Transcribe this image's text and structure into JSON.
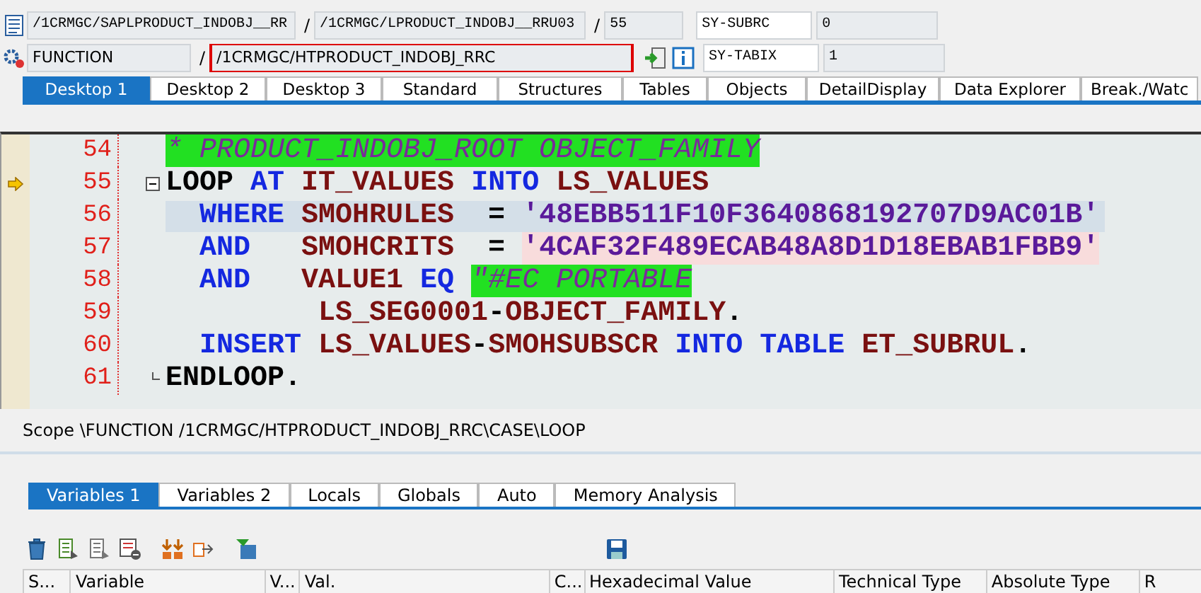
{
  "header": {
    "program": "/1CRMGC/SAPLPRODUCT_INDOBJ__RR",
    "separator_1": "/",
    "include": "/1CRMGC/LPRODUCT_INDOBJ__RRU03",
    "separator_2": "/",
    "line": "55",
    "event_type": "FUNCTION",
    "separator_3": "/",
    "event": "/1CRMGC/HTPRODUCT_INDOBJ_RRC",
    "sys_fields": [
      {
        "name": "SY-SUBRC",
        "value": "0"
      },
      {
        "name": "SY-TABIX",
        "value": "1"
      }
    ]
  },
  "desktop_tabs": [
    {
      "label": "Desktop 1",
      "selected": true
    },
    {
      "label": "Desktop 2",
      "selected": false
    },
    {
      "label": "Desktop 3",
      "selected": false
    },
    {
      "label": "Standard",
      "selected": false
    },
    {
      "label": "Structures",
      "selected": false
    },
    {
      "label": "Tables",
      "selected": false
    },
    {
      "label": "Objects",
      "selected": false
    },
    {
      "label": "DetailDisplay",
      "selected": false
    },
    {
      "label": "Data Explorer",
      "selected": false
    },
    {
      "label": "Break./Watc",
      "selected": false
    }
  ],
  "code_lines": [
    {
      "number": "54",
      "selected": false,
      "tokens": [
        {
          "text": "* PRODUCT_INDOBJ_ROOT OBJECT_FAMILY",
          "kind": "comment",
          "highlighted": true
        }
      ]
    },
    {
      "number": "55",
      "current": true,
      "selected": false,
      "fold_start": true,
      "tokens": [
        {
          "text": "LOOP",
          "kind": "statement"
        },
        {
          "text": " AT",
          "kind": "keyword"
        },
        {
          "text": " IT_VALUES",
          "kind": "ident"
        },
        {
          "text": " INTO",
          "kind": "keyword"
        },
        {
          "text": " LS_VALUES",
          "kind": "ident"
        }
      ]
    },
    {
      "number": "56",
      "selected": true,
      "tokens": [
        {
          "text": "  WHERE",
          "kind": "keyword"
        },
        {
          "text": " SMOHRULES",
          "kind": "ident"
        },
        {
          "text": "  = ",
          "kind": "operator"
        },
        {
          "text": "'48EBB511F10F3640868192707D9AC01B'",
          "kind": "literal"
        }
      ]
    },
    {
      "number": "57",
      "selected": false,
      "tokens": [
        {
          "text": "  AND",
          "kind": "keyword"
        },
        {
          "text": "   SMOHCRITS",
          "kind": "ident"
        },
        {
          "text": "  = ",
          "kind": "operator"
        },
        {
          "text": "'4CAF32F489ECAB48A8D1D18EBAB1FBB9'",
          "kind": "literal",
          "highlighted": true
        }
      ]
    },
    {
      "number": "58",
      "selected": false,
      "tokens": [
        {
          "text": "  AND",
          "kind": "keyword"
        },
        {
          "text": "   VALUE1",
          "kind": "ident"
        },
        {
          "text": " EQ ",
          "kind": "keyword"
        },
        {
          "text": "\"#EC PORTABLE",
          "kind": "comment",
          "highlighted": true
        }
      ]
    },
    {
      "number": "59",
      "selected": false,
      "tokens": [
        {
          "text": "         LS_SEG0001",
          "kind": "ident"
        },
        {
          "text": "-",
          "kind": "operator"
        },
        {
          "text": "OBJECT_FAMILY",
          "kind": "ident"
        },
        {
          "text": ".",
          "kind": "operator"
        }
      ]
    },
    {
      "number": "60",
      "selected": false,
      "tokens": [
        {
          "text": "  INSERT",
          "kind": "keyword"
        },
        {
          "text": " LS_VALUES",
          "kind": "ident"
        },
        {
          "text": "-",
          "kind": "operator"
        },
        {
          "text": "SMOHSUBSCR",
          "kind": "ident"
        },
        {
          "text": " INTO",
          "kind": "keyword"
        },
        {
          "text": " TABLE",
          "kind": "keyword"
        },
        {
          "text": " ET_SUBRUL",
          "kind": "ident"
        },
        {
          "text": ".",
          "kind": "operator"
        }
      ]
    },
    {
      "number": "61",
      "selected": false,
      "fold_end": true,
      "tokens": [
        {
          "text": "ENDLOOP",
          "kind": "statement"
        },
        {
          "text": ".",
          "kind": "operator"
        }
      ]
    }
  ],
  "scope": "Scope \\FUNCTION /1CRMGC/HTPRODUCT_INDOBJ_RRC\\CASE\\LOOP",
  "variable_tabs": [
    {
      "label": "Variables 1",
      "selected": true
    },
    {
      "label": "Variables 2",
      "selected": false
    },
    {
      "label": "Locals",
      "selected": false
    },
    {
      "label": "Globals",
      "selected": false
    },
    {
      "label": "Auto",
      "selected": false
    },
    {
      "label": "Memory Analysis",
      "selected": false
    }
  ],
  "table": {
    "columns": [
      "S...",
      "Variable",
      "V...",
      "Val.",
      "C...",
      "Hexadecimal Value",
      "Technical Type",
      "Absolute Type",
      "R"
    ]
  }
}
